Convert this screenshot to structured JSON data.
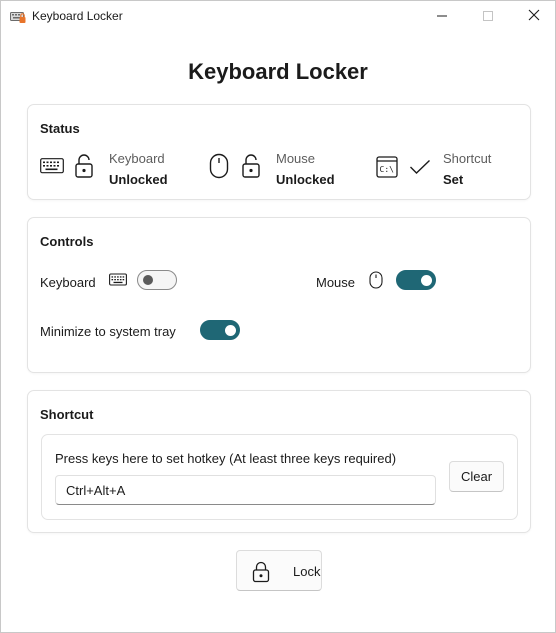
{
  "window": {
    "title": "Keyboard Locker",
    "app_icon": "keyboard-lock-icon",
    "controls": [
      "minimize-icon",
      "maximize-icon",
      "close-icon"
    ]
  },
  "heading": "Keyboard Locker",
  "status": {
    "title": "Status",
    "keyboard": {
      "label": "Keyboard",
      "value": "Unlocked",
      "icon": "keyboard-icon",
      "state_icon": "unlocked-padlock-icon"
    },
    "mouse": {
      "label": "Mouse",
      "value": "Unlocked",
      "icon": "mouse-icon",
      "state_icon": "unlocked-padlock-icon"
    },
    "shortcut": {
      "label": "Shortcut",
      "value": "Set",
      "icon": "command-prompt-icon",
      "state_icon": "checkmark-icon"
    }
  },
  "controls": {
    "title": "Controls",
    "keyboard": {
      "label": "Keyboard",
      "on": false
    },
    "mouse": {
      "label": "Mouse",
      "on": true
    },
    "tray": {
      "label": "Minimize to system tray",
      "on": true
    }
  },
  "shortcut": {
    "title": "Shortcut",
    "hint": "Press keys here to set hotkey (At least three keys required)",
    "value": "Ctrl+Alt+A",
    "clear_label": "Clear"
  },
  "lock_button": {
    "label": "Lock",
    "icon": "padlock-icon"
  },
  "colors": {
    "accent": "#1f6775",
    "toggle_off_knob": "#5a5a5a",
    "border": "#e3e3e3"
  }
}
